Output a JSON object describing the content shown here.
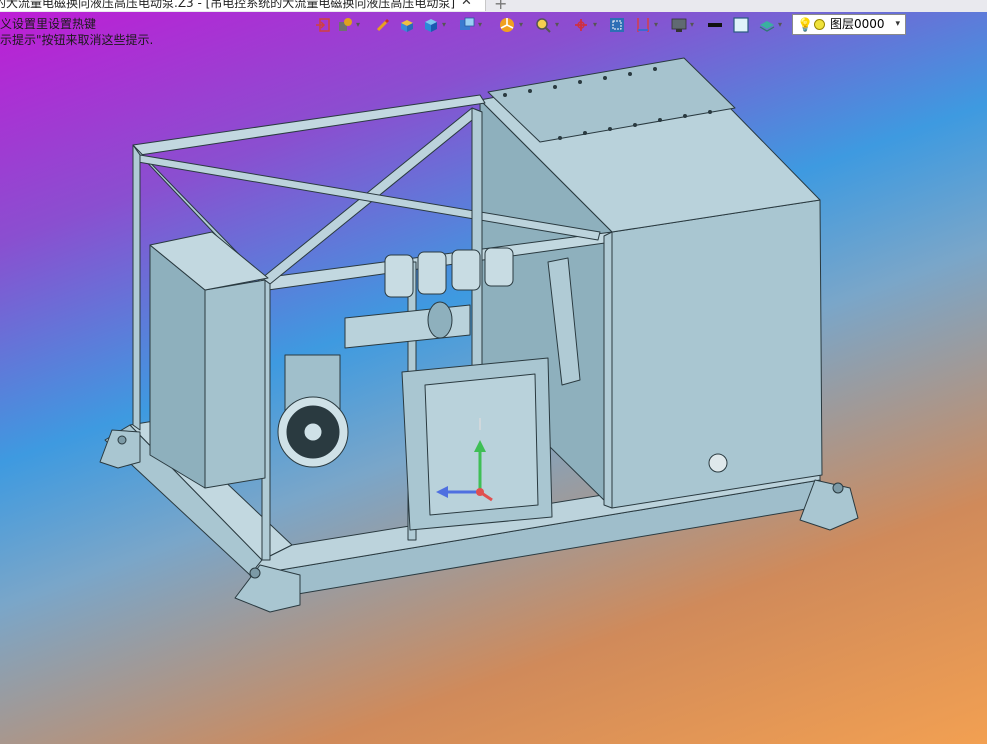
{
  "window": {
    "tab_title": "的大流量电磁换向液压高压电动泵.Z3 - [吊电控系统的大流量电磁换向液压高压电动泵]",
    "tab_close": "✕",
    "tab_add": "+"
  },
  "hints": {
    "line1": "义设置里设置热键",
    "line2": "示提示\"按钮来取消这些提示."
  },
  "toolbar": {
    "layer_name": "图层0000",
    "layer_dropdown": "▾",
    "dropdown_glyph": "▾"
  },
  "colors": {
    "steel": "#a9c6d1",
    "steel_dark": "#86a8b5",
    "steel_light": "#cfe1e7",
    "edge": "#2a3a40",
    "axis_z": "#3fbf55",
    "axis_x": "#4f6fe0",
    "axis_y": "#e05050"
  }
}
